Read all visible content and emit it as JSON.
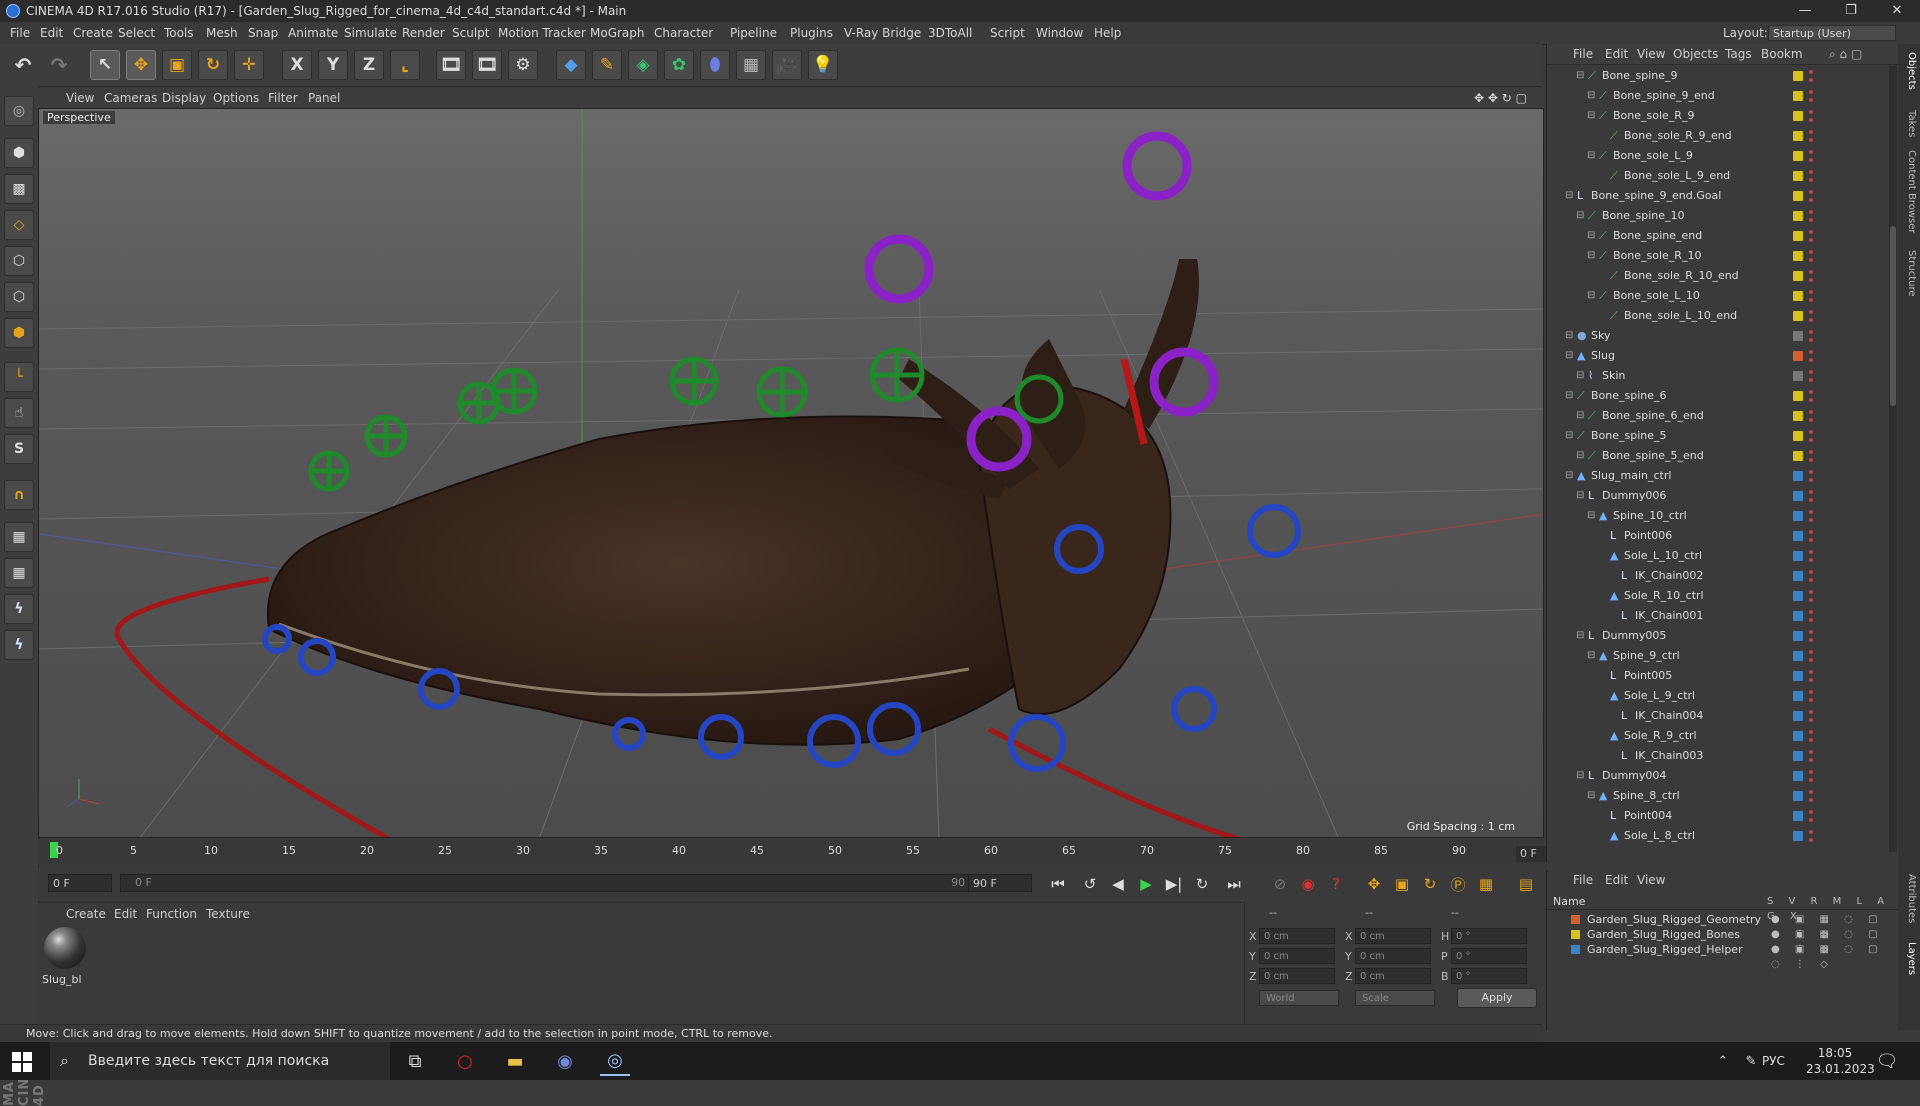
{
  "window": {
    "title": "CINEMA 4D R17.016 Studio (R17) - [Garden_Slug_Rigged_for_cinema_4d_c4d_standart.c4d *] - Main",
    "minimize": "—",
    "maximize": "❐",
    "close": "✕"
  },
  "menubar": {
    "items": [
      "File",
      "Edit",
      "Create",
      "Select",
      "Tools",
      "Mesh",
      "Snap",
      "Animate",
      "Simulate",
      "Render",
      "Sculpt",
      "Motion Tracker",
      "MoGraph",
      "Character",
      "Pipeline",
      "Plugins",
      "V-Ray Bridge",
      "3DToAll",
      "Script",
      "Window",
      "Help"
    ],
    "layout_label": "Layout:",
    "layout_value": "Startup (User)"
  },
  "toolbar": {
    "axis_x": "X",
    "axis_y": "Y",
    "axis_z": "Z"
  },
  "viewport": {
    "menu": [
      "View",
      "Cameras",
      "Display",
      "Options",
      "Filter",
      "Panel"
    ],
    "label": "Perspective",
    "grid_spacing": "Grid Spacing : 1 cm"
  },
  "timeline": {
    "ticks": [
      "0",
      "5",
      "10",
      "15",
      "20",
      "25",
      "30",
      "35",
      "40",
      "45",
      "50",
      "55",
      "60",
      "65",
      "70",
      "75",
      "80",
      "85",
      "90"
    ],
    "current_frame": "0 F",
    "start_field": "0 F",
    "range_start": "0 F",
    "range_end": "90 F",
    "end_field": "90 F"
  },
  "material_manager": {
    "menu": [
      "Create",
      "Edit",
      "Function",
      "Texture"
    ],
    "material_name": "Slug_bl"
  },
  "coordinates": {
    "header": [
      "--",
      "--",
      "--"
    ],
    "rows": [
      {
        "a": "X",
        "av": "0 cm",
        "b": "X",
        "bv": "0 cm",
        "c": "H",
        "cv": "0 °"
      },
      {
        "a": "Y",
        "av": "0 cm",
        "b": "Y",
        "bv": "0 cm",
        "c": "P",
        "cv": "0 °"
      },
      {
        "a": "Z",
        "av": "0 cm",
        "b": "Z",
        "bv": "0 cm",
        "c": "B",
        "cv": "0 °"
      }
    ],
    "space": "World",
    "mode": "Scale",
    "apply": "Apply"
  },
  "status": "Move: Click and drag to move elements. Hold down SHIFT to quantize movement / add to the selection in point mode, CTRL to remove.",
  "object_manager": {
    "menu": [
      "File",
      "Edit",
      "View",
      "Objects",
      "Tags",
      "Bookm"
    ],
    "tag_yellow": "#d8c21d",
    "tag_blue": "#3b83c9",
    "tag_orange": "#d4612c",
    "rows": [
      {
        "name": "Bone_spine_9",
        "indent": 3,
        "icon": "bone",
        "tag": "#d8c21d"
      },
      {
        "name": "Bone_spine_9_end",
        "indent": 4,
        "icon": "bone",
        "tag": "#d8c21d"
      },
      {
        "name": "Bone_sole_R_9",
        "indent": 4,
        "icon": "bone",
        "tag": "#d8c21d"
      },
      {
        "name": "Bone_sole_R_9_end",
        "indent": 5,
        "icon": "bone",
        "tag": "#d8c21d"
      },
      {
        "name": "Bone_sole_L_9",
        "indent": 4,
        "icon": "bone",
        "tag": "#d8c21d"
      },
      {
        "name": "Bone_sole_L_9_end",
        "indent": 5,
        "icon": "bone",
        "tag": "#d8c21d"
      },
      {
        "name": "Bone_spine_9_end.Goal",
        "indent": 2,
        "icon": "null",
        "tag": "#d8c21d"
      },
      {
        "name": "Bone_spine_10",
        "indent": 3,
        "icon": "bone",
        "tag": "#d8c21d"
      },
      {
        "name": "Bone_spine_end",
        "indent": 4,
        "icon": "bone",
        "tag": "#d8c21d"
      },
      {
        "name": "Bone_sole_R_10",
        "indent": 4,
        "icon": "bone",
        "tag": "#d8c21d"
      },
      {
        "name": "Bone_sole_R_10_end",
        "indent": 5,
        "icon": "bone",
        "tag": "#d8c21d"
      },
      {
        "name": "Bone_sole_L_10",
        "indent": 4,
        "icon": "bone",
        "tag": "#d8c21d"
      },
      {
        "name": "Bone_sole_L_10_end",
        "indent": 5,
        "icon": "bone",
        "tag": "#d8c21d"
      },
      {
        "name": "Sky",
        "indent": 2,
        "icon": "sky",
        "tag": "#777777"
      },
      {
        "name": "Slug",
        "indent": 2,
        "icon": "poly",
        "tag": "#d4612c"
      },
      {
        "name": "Skin",
        "indent": 3,
        "icon": "skin",
        "tag": "#777777"
      },
      {
        "name": "Bone_spine_6",
        "indent": 2,
        "icon": "bone",
        "tag": "#d8c21d"
      },
      {
        "name": "Bone_spine_6_end",
        "indent": 3,
        "icon": "bone",
        "tag": "#d8c21d"
      },
      {
        "name": "Bone_spine_5",
        "indent": 2,
        "icon": "bone",
        "tag": "#d8c21d"
      },
      {
        "name": "Bone_spine_5_end",
        "indent": 3,
        "icon": "bone",
        "tag": "#d8c21d"
      },
      {
        "name": "Slug_main_ctrl",
        "indent": 2,
        "icon": "poly",
        "tag": "#3b83c9"
      },
      {
        "name": "Dummy006",
        "indent": 3,
        "icon": "null",
        "tag": "#3b83c9"
      },
      {
        "name": "Spine_10_ctrl",
        "indent": 4,
        "icon": "poly",
        "tag": "#3b83c9"
      },
      {
        "name": "Point006",
        "indent": 5,
        "icon": "null",
        "tag": "#3b83c9"
      },
      {
        "name": "Sole_L_10_ctrl",
        "indent": 5,
        "icon": "poly",
        "tag": "#3b83c9"
      },
      {
        "name": "IK_Chain002",
        "indent": 6,
        "icon": "null",
        "tag": "#3b83c9"
      },
      {
        "name": "Sole_R_10_ctrl",
        "indent": 5,
        "icon": "poly",
        "tag": "#3b83c9"
      },
      {
        "name": "IK_Chain001",
        "indent": 6,
        "icon": "null",
        "tag": "#3b83c9"
      },
      {
        "name": "Dummy005",
        "indent": 3,
        "icon": "null",
        "tag": "#3b83c9"
      },
      {
        "name": "Spine_9_ctrl",
        "indent": 4,
        "icon": "poly",
        "tag": "#3b83c9"
      },
      {
        "name": "Point005",
        "indent": 5,
        "icon": "null",
        "tag": "#3b83c9"
      },
      {
        "name": "Sole_L_9_ctrl",
        "indent": 5,
        "icon": "poly",
        "tag": "#3b83c9"
      },
      {
        "name": "IK_Chain004",
        "indent": 6,
        "icon": "null",
        "tag": "#3b83c9"
      },
      {
        "name": "Sole_R_9_ctrl",
        "indent": 5,
        "icon": "poly",
        "tag": "#3b83c9"
      },
      {
        "name": "IK_Chain003",
        "indent": 6,
        "icon": "null",
        "tag": "#3b83c9"
      },
      {
        "name": "Dummy004",
        "indent": 3,
        "icon": "null",
        "tag": "#3b83c9"
      },
      {
        "name": "Spine_8_ctrl",
        "indent": 4,
        "icon": "poly",
        "tag": "#3b83c9"
      },
      {
        "name": "Point004",
        "indent": 5,
        "icon": "null",
        "tag": "#3b83c9"
      },
      {
        "name": "Sole_L_8_ctrl",
        "indent": 5,
        "icon": "poly",
        "tag": "#3b83c9"
      }
    ]
  },
  "layers": {
    "menu": [
      "File",
      "Edit",
      "View"
    ],
    "header": {
      "name": "Name",
      "cols": "S V R M L A G X"
    },
    "rows": [
      {
        "name": "Garden_Slug_Rigged_Geometry",
        "color": "#d4612c"
      },
      {
        "name": "Garden_Slug_Rigged_Bones",
        "color": "#d8c21d"
      },
      {
        "name": "Garden_Slug_Rigged_Helper",
        "color": "#3b83c9"
      }
    ]
  },
  "right_tabs": [
    "Objects",
    "Takes",
    "Content Browser",
    "Structure",
    "Attributes",
    "Layers"
  ],
  "taskbar": {
    "search_placeholder": "Введите здесь текст для поиска",
    "language": "РУС",
    "time": "18:05",
    "date": "23.01.2023"
  }
}
